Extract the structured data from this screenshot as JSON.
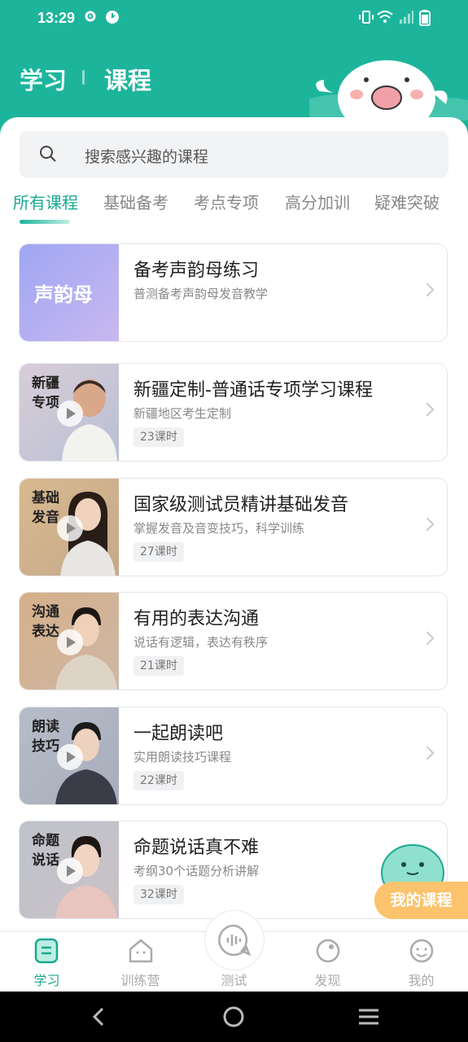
{
  "status_bar": {
    "time": "13:29"
  },
  "header": {
    "tab_study": "学习",
    "tab_course": "课程"
  },
  "search": {
    "placeholder": "搜索感兴趣的课程"
  },
  "category_tabs": [
    "所有课程",
    "基础备考",
    "考点专项",
    "高分加训",
    "疑难突破"
  ],
  "active_tab_index": 0,
  "courses": [
    {
      "thumb_text": "声韵母",
      "title": "备考声韵母练习",
      "subtitle": "普测备考声韵母发音教学",
      "lessons": ""
    },
    {
      "thumb_text": "新疆专项",
      "title": "新疆定制-普通话专项学习课程",
      "subtitle": "新疆地区考生定制",
      "lessons": "23课时"
    },
    {
      "thumb_text": "基础发音",
      "title": "国家级测试员精讲基础发音",
      "subtitle": "掌握发音及音变技巧，科学训练",
      "lessons": "27课时"
    },
    {
      "thumb_text": "沟通表达",
      "title": "有用的表达沟通",
      "subtitle": "说话有逻辑，表达有秩序",
      "lessons": "21课时"
    },
    {
      "thumb_text": "朗读技巧",
      "title": "一起朗读吧",
      "subtitle": "实用朗读技巧课程",
      "lessons": "22课时"
    },
    {
      "thumb_text": "命题说话",
      "title": "命题说话真不难",
      "subtitle": "考纲30个话题分析讲解",
      "lessons": "32课时"
    }
  ],
  "floating": {
    "my_courses": "我的课程"
  },
  "bottom_nav": {
    "study": "学习",
    "camp": "训练营",
    "test": "测试",
    "discover": "发现",
    "mine": "我的"
  },
  "colors": {
    "brand": "#1db49c",
    "accent_orange": "#fbc36b"
  }
}
